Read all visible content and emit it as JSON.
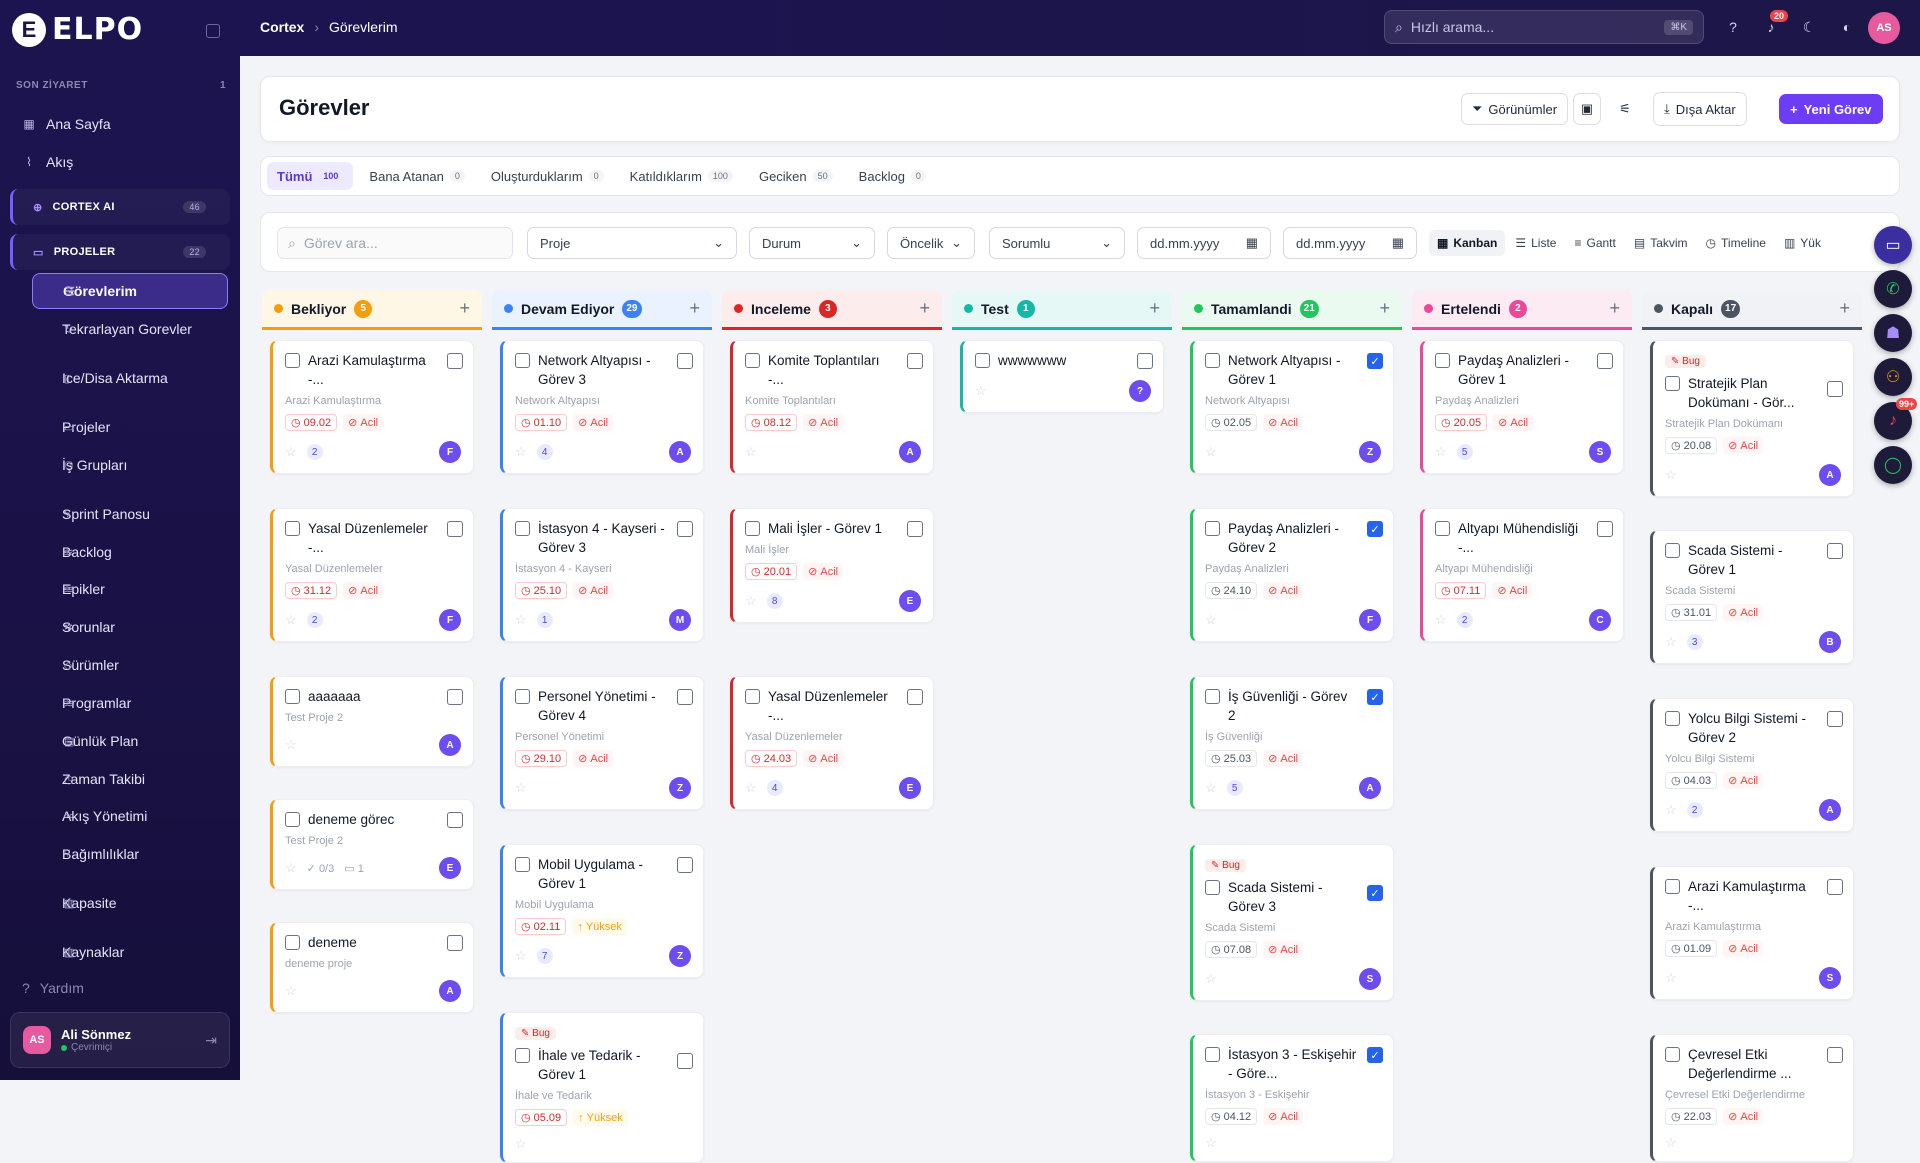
{
  "brand": {
    "logo_letter": "E",
    "logo_text": "ELPO"
  },
  "sidebar": {
    "recent_label": "SON ZİYARET",
    "recent_count": "1",
    "home": "Ana Sayfa",
    "flow": "Akış",
    "cortex_label": "CORTEX AI",
    "cortex_count": "46",
    "projects_label": "PROJELER",
    "projects_count": "22",
    "items": [
      "Görevlerim",
      "Tekrarlayan Gorevler",
      "Ice/Disa Aktarma",
      "Projeler",
      "İş Grupları",
      "Sprint Panosu",
      "Backlog",
      "Epikler",
      "Sorunlar",
      "Sürümler",
      "Programlar",
      "Günlük Plan",
      "Zaman Takibi",
      "Akış Yönetimi",
      "Bağımlılıklar",
      "Kapasite",
      "Kaynaklar"
    ],
    "help": "Yardım",
    "user": {
      "initials": "AS",
      "name": "Ali Sönmez",
      "status": "Çevrimiçi"
    }
  },
  "topbar": {
    "crumb_root": "Cortex",
    "crumb_current": "Görevlerim",
    "search_placeholder": "Hızlı arama...",
    "search_kbd": "⌘K",
    "notif_count": "20",
    "avatar": "AS"
  },
  "header": {
    "title": "Görevler",
    "views_btn": "Görünümler",
    "export_btn": "Dışa Aktar",
    "new_btn": "Yeni Görev"
  },
  "tabs": [
    {
      "label": "Tümü",
      "count": "100"
    },
    {
      "label": "Bana Atanan",
      "count": "0"
    },
    {
      "label": "Oluşturduklarım",
      "count": "0"
    },
    {
      "label": "Katıldıklarım",
      "count": "100"
    },
    {
      "label": "Geciken",
      "count": "50"
    },
    {
      "label": "Backlog",
      "count": "0"
    }
  ],
  "filters": {
    "search_placeholder": "Görev ara...",
    "project": "Proje",
    "status": "Durum",
    "priority": "Öncelik",
    "owner": "Sorumlu",
    "date1": "dd.mm.yyyy",
    "date2": "dd.mm.yyyy"
  },
  "views": [
    "Kanban",
    "Liste",
    "Gantt",
    "Takvim",
    "Timeline",
    "Yük"
  ],
  "colors": {
    "accent": "#6d3df5",
    "bekliyor": "#f59e0b",
    "devam": "#3b82f6",
    "inceleme": "#dc2626",
    "test": "#14b8a6",
    "tamam": "#22c55e",
    "ertelendi": "#ec4899",
    "kapali": "#4b5563"
  },
  "columns": [
    {
      "title": "Bekliyor",
      "count": "5",
      "cards": [
        {
          "title": "Arazi Kamulaştırma -...",
          "project": "Arazi Kamulaştırma",
          "date": "09.02",
          "priority": "Acil",
          "subs": "2",
          "assignee": "F"
        },
        {
          "title": "Yasal Düzenlemeler -...",
          "project": "Yasal Düzenlemeler",
          "date": "31.12",
          "priority": "Acil",
          "subs": "2",
          "assignee": "F"
        },
        {
          "title": "aaaaaaa",
          "project": "Test Proje 2",
          "assignee": "A"
        },
        {
          "title": "deneme görec",
          "project": "Test Proje 2",
          "checklist": "0/3",
          "comments": "1",
          "assignee": "E"
        },
        {
          "title": "deneme",
          "project": "deneme proje",
          "assignee": "A"
        }
      ]
    },
    {
      "title": "Devam Ediyor",
      "count": "29",
      "cards": [
        {
          "title": "Network Altyapısı - Görev 3",
          "project": "Network Altyapısı",
          "date": "01.10",
          "priority": "Acil",
          "subs": "4",
          "assignee": "A"
        },
        {
          "title": "İstasyon 4 - Kayseri - Görev 3",
          "project": "İstasyon 4 - Kayseri",
          "date": "25.10",
          "priority": "Acil",
          "subs": "1",
          "assignee": "M"
        },
        {
          "title": "Personel Yönetimi - Görev 4",
          "project": "Personel Yönetimi",
          "date": "29.10",
          "priority": "Acil",
          "assignee": "Z"
        },
        {
          "title": "Mobil Uygulama - Görev 1",
          "project": "Mobil Uygulama",
          "date": "02.11",
          "priority": "Yüksek",
          "subs": "7",
          "assignee": "Z"
        },
        {
          "bug": "Bug",
          "title": "İhale ve Tedarik - Görev 1",
          "project": "İhale ve Tedarik",
          "date": "05.09",
          "priority": "Yüksek"
        }
      ]
    },
    {
      "title": "Inceleme",
      "count": "3",
      "cards": [
        {
          "title": "Komite Toplantıları -...",
          "project": "Komite Toplantıları",
          "date": "08.12",
          "priority": "Acil",
          "assignee": "A"
        },
        {
          "title": "Mali İşler - Görev 1",
          "project": "Mali İşler",
          "date": "20.01",
          "priority": "Acil",
          "subs": "8",
          "assignee": "E"
        },
        {
          "title": "Yasal Düzenlemeler -...",
          "project": "Yasal Düzenlemeler",
          "date": "24.03",
          "priority": "Acil",
          "subs": "4",
          "assignee": "E"
        }
      ]
    },
    {
      "title": "Test",
      "count": "1",
      "cards": [
        {
          "title": "wwwwwww",
          "assignee": "?"
        }
      ]
    },
    {
      "title": "Tamamlandi",
      "count": "21",
      "cards": [
        {
          "title": "Network Altyapısı - Görev 1",
          "project": "Network Altyapısı",
          "date": "02.05",
          "priority": "Acil",
          "assignee": "Z"
        },
        {
          "title": "Paydaş Analizleri - Görev 2",
          "project": "Paydaş Analizleri",
          "date": "24.10",
          "priority": "Acil",
          "assignee": "F"
        },
        {
          "title": "İş Güvenliği - Görev 2",
          "project": "İş Güvenliği",
          "date": "25.03",
          "priority": "Acil",
          "subs": "5",
          "assignee": "A"
        },
        {
          "bug": "Bug",
          "title": "Scada Sistemi - Görev 3",
          "project": "Scada Sistemi",
          "date": "07.08",
          "priority": "Acil",
          "assignee": "S"
        },
        {
          "title": "İstasyon 3 - Eskişehir - Göre...",
          "project": "İstasyon 3 - Eskişehir",
          "date": "04.12",
          "priority": "Acil"
        }
      ]
    },
    {
      "title": "Ertelendi",
      "count": "2",
      "cards": [
        {
          "title": "Paydaş Analizleri - Görev 1",
          "project": "Paydaş Analizleri",
          "date": "20.05",
          "priority": "Acil",
          "subs": "5",
          "assignee": "S"
        },
        {
          "title": "Altyapı Mühendisliği -...",
          "project": "Altyapı Mühendisliği",
          "date": "07.11",
          "priority": "Acil",
          "subs": "2",
          "assignee": "C"
        }
      ]
    },
    {
      "title": "Kapalı",
      "count": "17",
      "cards": [
        {
          "bug": "Bug",
          "title": "Stratejik Plan Dokümanı - Gör...",
          "project": "Stratejik Plan Dokümanı",
          "date": "20.08",
          "priority": "Acil",
          "assignee": "A"
        },
        {
          "title": "Scada Sistemi - Görev 1",
          "project": "Scada Sistemi",
          "date": "31.01",
          "priority": "Acil",
          "subs": "3",
          "assignee": "B"
        },
        {
          "title": "Yolcu Bilgi Sistemi - Görev 2",
          "project": "Yolcu Bilgi Sistemi",
          "date": "04.03",
          "priority": "Acil",
          "subs": "2",
          "assignee": "A"
        },
        {
          "title": "Arazi Kamulaştırma -...",
          "project": "Arazi Kamulaştırma",
          "date": "01.09",
          "priority": "Acil",
          "assignee": "S"
        },
        {
          "title": "Çevresel Etki Değerlendirme ...",
          "project": "Çevresel Etki Değerlendirme",
          "date": "22.03",
          "priority": "Acil"
        }
      ]
    }
  ],
  "fab": {
    "notif": "99+"
  }
}
